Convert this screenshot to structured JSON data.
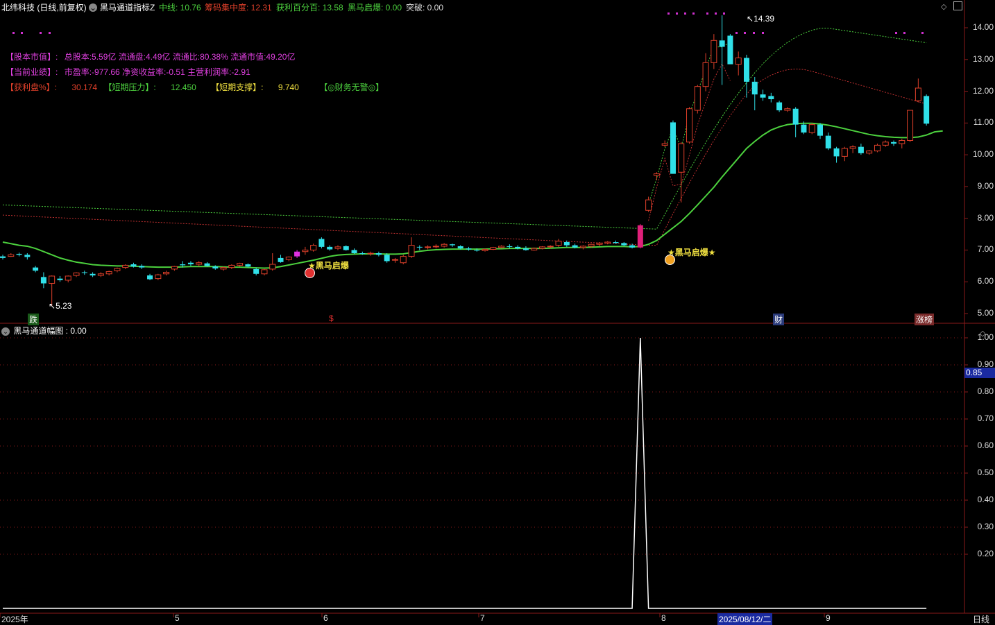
{
  "header": {
    "stock_title": "北纬科技 (日线,前复权)",
    "indicator_name": "黑马通道指标Z",
    "mid_line": "中线: 10.76",
    "chip_conc": "筹码集中度: 12.31",
    "profit_pct": "获利百分百: 13.58",
    "black_horse": "黑马启爆: 0.00",
    "breakout": "突破: 0.00"
  },
  "info": {
    "line1_tag": "【股本市值】:",
    "line1_val": "总股本:5.59亿 流通盘:4.49亿 流通比:80.38% 流通市值:49.20亿",
    "line2_tag": "【当前业绩】:",
    "line2_val": "市盈率:-977.66 净资收益率:-0.51 主营利润率:-2.91",
    "line3_tag1": "【获利盘%】:",
    "line3_val1": "30.174",
    "line3_tag2": "【短期压力】:",
    "line3_val2": "12.450",
    "line3_tag3": "【短期支撑】:",
    "line3_val3": "9.740",
    "line3_tag4": "【◎财务无警◎】"
  },
  "annotations": {
    "high": "14.39",
    "low": "5.23",
    "signal1": "★黑马启爆",
    "signal2": "★黑马启爆★",
    "badge_left": "跌",
    "badge_dollar": "$",
    "badge_cai": "财",
    "badge_zhang": "涨榜"
  },
  "sub_panel": {
    "title": "黑马通道幅图 : 0.00",
    "cursor_value": "0.85"
  },
  "price_axis": [
    "14.00",
    "13.00",
    "12.00",
    "11.00",
    "10.00",
    "9.00",
    "8.00",
    "7.00",
    "6.00",
    "5.00"
  ],
  "sub_axis": [
    "1.00",
    "0.90",
    "0.80",
    "0.70",
    "0.60",
    "0.50",
    "0.40",
    "0.30",
    "0.20"
  ],
  "x_axis": {
    "labels": [
      "2025年",
      "5",
      "6",
      "7",
      "8",
      "9"
    ],
    "cursor_date": "2025/08/12/二",
    "period": "日线"
  },
  "chart_data": {
    "type": "candlestick",
    "ylim": [
      5.0,
      14.4
    ],
    "sub_ylim": [
      0,
      1.0
    ],
    "candles": [
      [
        6.8,
        6.85,
        6.7,
        6.75
      ],
      [
        6.8,
        6.9,
        6.78,
        6.85
      ],
      [
        6.88,
        6.92,
        6.8,
        6.85
      ],
      [
        6.85,
        6.9,
        6.7,
        6.78
      ],
      [
        6.45,
        6.5,
        6.3,
        6.35
      ],
      [
        6.15,
        6.3,
        5.8,
        5.95
      ],
      [
        5.95,
        6.2,
        5.23,
        6.18
      ],
      [
        6.1,
        6.18,
        6.0,
        6.05
      ],
      [
        6.05,
        6.2,
        5.98,
        6.18
      ],
      [
        6.2,
        6.3,
        6.15,
        6.28
      ],
      [
        6.3,
        6.35,
        6.22,
        6.28
      ],
      [
        6.25,
        6.3,
        6.15,
        6.2
      ],
      [
        6.2,
        6.3,
        6.15,
        6.25
      ],
      [
        6.25,
        6.35,
        6.2,
        6.32
      ],
      [
        6.35,
        6.45,
        6.3,
        6.42
      ],
      [
        6.45,
        6.55,
        6.4,
        6.52
      ],
      [
        6.55,
        6.6,
        6.45,
        6.48
      ],
      [
        6.5,
        6.55,
        6.4,
        6.45
      ],
      [
        6.2,
        6.25,
        6.05,
        6.08
      ],
      [
        6.1,
        6.25,
        6.05,
        6.22
      ],
      [
        6.25,
        6.35,
        6.2,
        6.3
      ],
      [
        6.4,
        6.5,
        6.35,
        6.48
      ],
      [
        6.55,
        6.65,
        6.45,
        6.52
      ],
      [
        6.6,
        6.65,
        6.5,
        6.55
      ],
      [
        6.55,
        6.65,
        6.48,
        6.6
      ],
      [
        6.58,
        6.62,
        6.48,
        6.5
      ],
      [
        6.48,
        6.52,
        6.38,
        6.42
      ],
      [
        6.4,
        6.48,
        6.35,
        6.45
      ],
      [
        6.45,
        6.55,
        6.4,
        6.52
      ],
      [
        6.52,
        6.6,
        6.48,
        6.58
      ],
      [
        6.55,
        6.58,
        6.45,
        6.48
      ],
      [
        6.4,
        6.45,
        6.2,
        6.25
      ],
      [
        6.25,
        6.4,
        6.2,
        6.38
      ],
      [
        6.4,
        6.9,
        6.35,
        6.55
      ],
      [
        6.75,
        6.85,
        6.6,
        6.62
      ],
      [
        6.7,
        6.8,
        6.65,
        6.78
      ],
      [
        6.8,
        7.0,
        6.75,
        6.95
      ],
      [
        6.95,
        7.1,
        6.85,
        7.0
      ],
      [
        7.0,
        7.2,
        6.95,
        7.15
      ],
      [
        7.35,
        7.4,
        7.05,
        7.1
      ],
      [
        7.1,
        7.15,
        6.98,
        7.02
      ],
      [
        7.05,
        7.15,
        7.0,
        7.1
      ],
      [
        7.12,
        7.15,
        6.98,
        7.0
      ],
      [
        7.0,
        7.05,
        6.88,
        6.9
      ],
      [
        6.9,
        6.95,
        6.85,
        6.88
      ],
      [
        6.88,
        6.95,
        6.82,
        6.9
      ],
      [
        6.9,
        6.95,
        6.8,
        6.85
      ],
      [
        6.85,
        6.9,
        6.6,
        6.65
      ],
      [
        6.68,
        6.75,
        6.6,
        6.7
      ],
      [
        6.6,
        6.85,
        6.55,
        6.8
      ],
      [
        6.8,
        7.4,
        6.75,
        7.15
      ],
      [
        7.1,
        7.15,
        7.0,
        7.08
      ],
      [
        7.08,
        7.15,
        7.02,
        7.1
      ],
      [
        7.1,
        7.18,
        7.05,
        7.12
      ],
      [
        7.12,
        7.22,
        7.08,
        7.18
      ],
      [
        7.18,
        7.2,
        7.1,
        7.15
      ],
      [
        7.12,
        7.15,
        7.02,
        7.05
      ],
      [
        7.05,
        7.1,
        6.98,
        7.02
      ],
      [
        7.0,
        7.05,
        6.95,
        6.98
      ],
      [
        6.98,
        7.05,
        6.95,
        7.02
      ],
      [
        7.02,
        7.1,
        7.0,
        7.08
      ],
      [
        7.08,
        7.15,
        7.05,
        7.12
      ],
      [
        7.12,
        7.18,
        7.05,
        7.1
      ],
      [
        7.1,
        7.15,
        7.02,
        7.05
      ],
      [
        7.05,
        7.12,
        6.98,
        7.0
      ],
      [
        7.0,
        7.08,
        6.98,
        7.05
      ],
      [
        7.05,
        7.12,
        7.02,
        7.1
      ],
      [
        7.1,
        7.15,
        7.05,
        7.12
      ],
      [
        7.15,
        7.35,
        7.1,
        7.28
      ],
      [
        7.25,
        7.3,
        7.1,
        7.15
      ],
      [
        7.15,
        7.2,
        7.05,
        7.08
      ],
      [
        7.08,
        7.15,
        7.02,
        7.12
      ],
      [
        7.12,
        7.2,
        7.08,
        7.18
      ],
      [
        7.18,
        7.25,
        7.12,
        7.22
      ],
      [
        7.22,
        7.28,
        7.18,
        7.25
      ],
      [
        7.25,
        7.3,
        7.2,
        7.22
      ],
      [
        7.22,
        7.25,
        7.12,
        7.15
      ],
      [
        7.15,
        7.2,
        7.05,
        7.08
      ],
      [
        7.08,
        7.82,
        7.05,
        7.78
      ],
      [
        8.25,
        8.68,
        8.2,
        8.58
      ],
      [
        9.35,
        9.45,
        9.2,
        9.4
      ],
      [
        10.3,
        10.45,
        10.25,
        10.35
      ],
      [
        11.02,
        11.08,
        9.4,
        9.4
      ],
      [
        9.45,
        10.4,
        8.5,
        10.35
      ],
      [
        10.4,
        11.5,
        10.35,
        11.45
      ],
      [
        11.4,
        12.2,
        11.3,
        12.15
      ],
      [
        12.15,
        13.2,
        12.0,
        12.9
      ],
      [
        12.9,
        13.8,
        12.7,
        13.6
      ],
      [
        13.6,
        14.39,
        12.2,
        13.4
      ],
      [
        13.75,
        13.8,
        12.9,
        12.85
      ],
      [
        12.85,
        13.25,
        12.5,
        13.05
      ],
      [
        13.05,
        13.15,
        11.8,
        12.3
      ],
      [
        12.3,
        12.45,
        11.4,
        11.9
      ],
      [
        11.9,
        12.05,
        11.7,
        11.8
      ],
      [
        11.85,
        11.95,
        11.65,
        11.75
      ],
      [
        11.65,
        11.7,
        11.35,
        11.4
      ],
      [
        11.4,
        11.5,
        11.35,
        11.45
      ],
      [
        11.45,
        11.5,
        10.55,
        10.95
      ],
      [
        10.95,
        11.05,
        10.65,
        10.7
      ],
      [
        10.7,
        11.0,
        10.65,
        10.95
      ],
      [
        10.95,
        11.0,
        10.5,
        10.6
      ],
      [
        10.6,
        10.7,
        10.15,
        10.2
      ],
      [
        10.2,
        10.25,
        9.75,
        9.95
      ],
      [
        9.95,
        10.25,
        9.8,
        10.2
      ],
      [
        10.2,
        10.3,
        10.05,
        10.25
      ],
      [
        10.25,
        10.35,
        10.0,
        10.05
      ],
      [
        10.05,
        10.15,
        10.0,
        10.12
      ],
      [
        10.12,
        10.35,
        10.08,
        10.3
      ],
      [
        10.3,
        10.45,
        10.25,
        10.4
      ],
      [
        10.4,
        10.45,
        10.28,
        10.35
      ],
      [
        10.35,
        10.5,
        10.2,
        10.45
      ],
      [
        10.45,
        11.4,
        10.4,
        11.4
      ],
      [
        11.7,
        12.4,
        11.65,
        12.1
      ],
      [
        11.85,
        11.9,
        10.92,
        10.98
      ]
    ],
    "ma_green": [
      7.25,
      7.2,
      7.15,
      7.12,
      7.05,
      6.95,
      6.85,
      6.75,
      6.68,
      6.62,
      6.58,
      6.54,
      6.52,
      6.51,
      6.5,
      6.5,
      6.49,
      6.48,
      6.47,
      6.46,
      6.46,
      6.46,
      6.47,
      6.48,
      6.48,
      6.48,
      6.48,
      6.47,
      6.46,
      6.46,
      6.45,
      6.44,
      6.43,
      6.44,
      6.48,
      6.53,
      6.58,
      6.63,
      6.68,
      6.74,
      6.8,
      6.84,
      6.86,
      6.87,
      6.88,
      6.88,
      6.88,
      6.87,
      6.87,
      6.88,
      6.92,
      6.96,
      6.99,
      7.01,
      7.02,
      7.03,
      7.03,
      7.03,
      7.03,
      7.03,
      7.04,
      7.04,
      7.05,
      7.05,
      7.05,
      7.05,
      7.05,
      7.06,
      7.07,
      7.08,
      7.08,
      7.08,
      7.09,
      7.1,
      7.11,
      7.11,
      7.11,
      7.1,
      7.11,
      7.18,
      7.3,
      7.5,
      7.7,
      7.9,
      8.15,
      8.42,
      8.7,
      8.98,
      9.3,
      9.6,
      9.9,
      10.2,
      10.42,
      10.62,
      10.78,
      10.88,
      10.95,
      10.98,
      10.99,
      10.99,
      10.97,
      10.93,
      10.88,
      10.82,
      10.76,
      10.7,
      10.64,
      10.6,
      10.57,
      10.55,
      10.54,
      10.54,
      10.56,
      10.62,
      10.72,
      10.75
    ]
  }
}
